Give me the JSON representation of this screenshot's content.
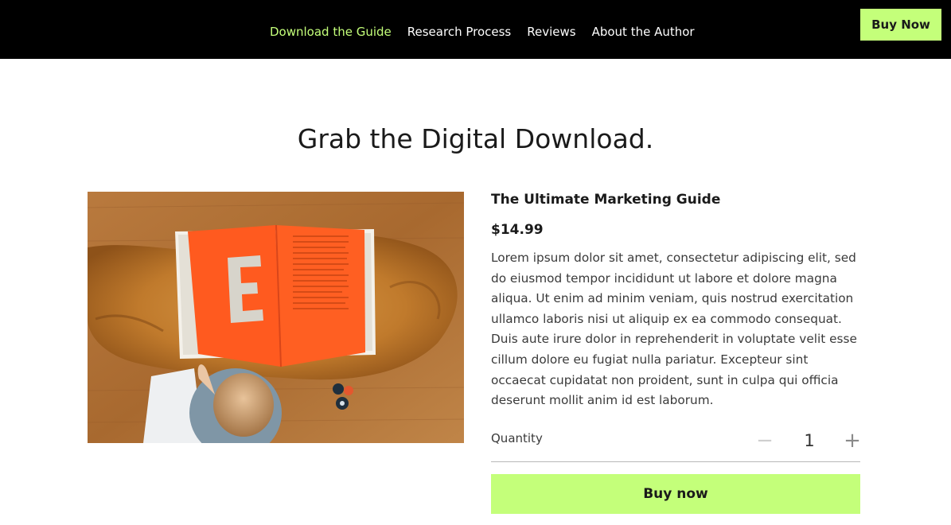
{
  "header": {
    "nav": [
      {
        "label": "Download the Guide",
        "active": true
      },
      {
        "label": "Research Process",
        "active": false
      },
      {
        "label": "Reviews",
        "active": false
      },
      {
        "label": "About the Author",
        "active": false
      }
    ],
    "buy_label": "Buy Now",
    "accent_color": "#c4ff7a",
    "background_color": "#000000"
  },
  "main": {
    "headline": "Grab the Digital Download.",
    "product": {
      "image_icon": "book-photo",
      "title": "The Ultimate Marketing Guide",
      "price": "$14.99",
      "description": "Lorem ipsum dolor sit amet, consectetur adipiscing elit, sed do eiusmod tempor incididunt ut labore et dolore magna aliqua. Ut enim ad minim veniam, quis nostrud exercitation ullamco laboris nisi ut aliquip ex ea commodo consequat. Duis aute irure dolor in reprehenderit in voluptate velit esse cillum dolore eu fugiat nulla pariatur. Excepteur sint occaecat cupidatat non proident, sunt in culpa qui officia deserunt mollit anim id est laborum.",
      "quantity_label": "Quantity",
      "quantity": "1",
      "buy_label": "Buy now"
    }
  }
}
